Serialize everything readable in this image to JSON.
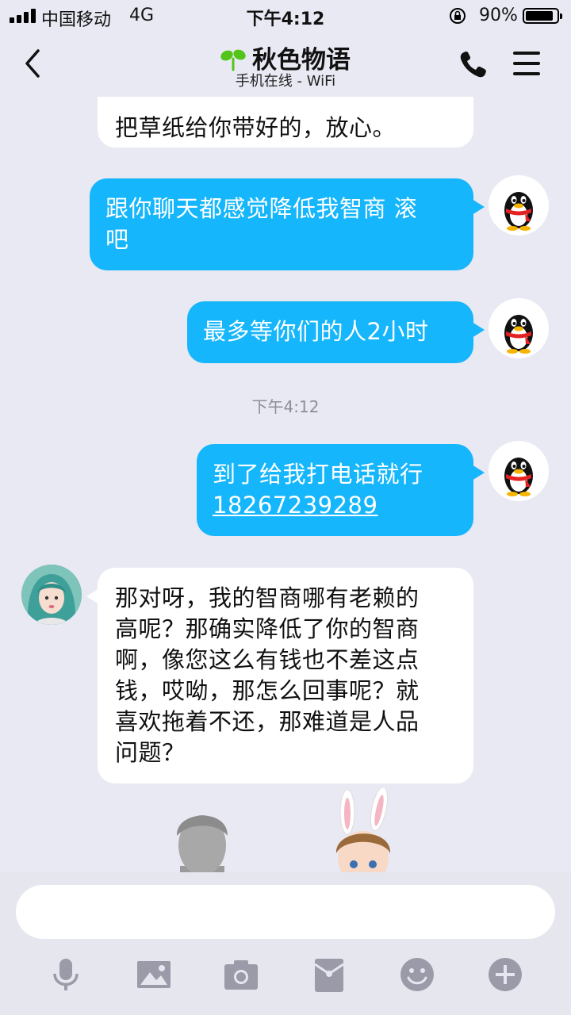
{
  "status_bar": {
    "carrier": "中国移动",
    "network": "4G",
    "time": "下午4:12",
    "battery": "90%",
    "battery_level": 0.9
  },
  "header": {
    "back_icon": "chevron-left-icon",
    "contact_name": "秋色物语",
    "status": "手机在线 - WiFi",
    "call_icon": "phone-icon",
    "menu_icon": "hamburger-menu-icon",
    "accent_color": "#52c41a"
  },
  "messages": [
    {
      "sender": "contact",
      "text": "把草纸给你带好的，放心。"
    },
    {
      "sender": "me",
      "lines": [
        "跟你聊天都感觉降低我智商 滚",
        "吧"
      ]
    },
    {
      "sender": "me",
      "text": "最多等你们的人2小时"
    },
    {
      "type": "timestamp",
      "text": "下午4:12"
    },
    {
      "sender": "me",
      "text": "到了给我打电话就行",
      "link": "18267239289"
    },
    {
      "sender": "contact",
      "lines": [
        "那对呀，我的智商哪有老赖的",
        "高呢？那确实降低了你的智商",
        "啊，像您这么有钱也不差这点",
        "钱，哎呦，那怎么回事呢？就",
        "喜欢拖着不还，那难道是人品",
        "问题？"
      ]
    }
  ],
  "colors": {
    "outgoing_bubble": "#15b6fb",
    "incoming_bubble": "#ffffff",
    "background": "#e9e9f3",
    "toolbar_icons": "#9a9aa8"
  },
  "input": {
    "placeholder": ""
  },
  "toolbar": [
    "microphone-icon",
    "image-icon",
    "camera-icon",
    "red-packet-icon",
    "emoji-icon",
    "plus-icon"
  ]
}
